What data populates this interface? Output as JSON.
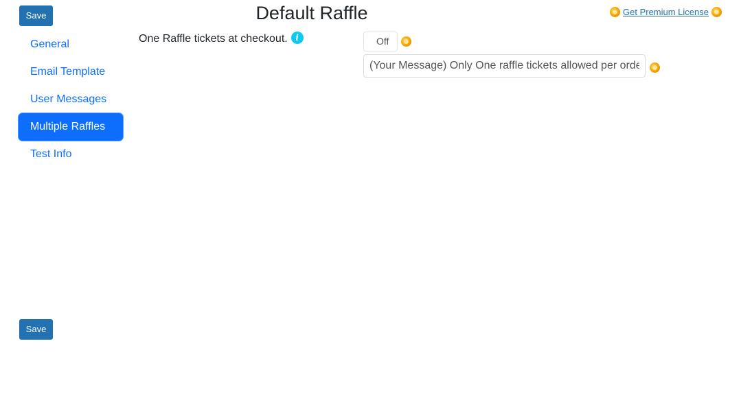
{
  "buttons": {
    "save_top": "Save",
    "save_bottom": "Save"
  },
  "header": {
    "title": "Default Raffle",
    "premium_link": "Get Premium License"
  },
  "sidebar": {
    "items": [
      {
        "label": "General",
        "active": false
      },
      {
        "label": "Email Template",
        "active": false
      },
      {
        "label": "User Messages",
        "active": false
      },
      {
        "label": "Multiple Raffles",
        "active": true
      },
      {
        "label": "Test Info",
        "active": false
      }
    ]
  },
  "settings": {
    "one_raffle_label": "One Raffle tickets at checkout.",
    "toggle_value": "Off",
    "message_value": "(Your Message) Only One raffle tickets allowed per orde"
  },
  "colors": {
    "primary": "#0d6efd",
    "wp_blue": "#2271b1",
    "info": "#0dcaf0",
    "premium_star": "#f5a000"
  },
  "icons": {
    "info": "info-icon",
    "premium": "premium-star-icon"
  }
}
